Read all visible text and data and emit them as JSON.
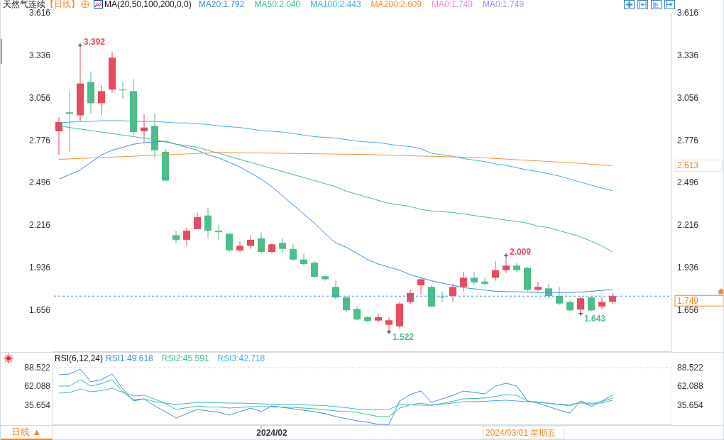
{
  "header": {
    "symbol": "天然气连续",
    "period": "【日线】",
    "indicator": "MA(20,50,100,200,0,0)",
    "values": [
      {
        "text": "MA20:1.792",
        "color": "#3d8ee6"
      },
      {
        "text": "MA50:2.040",
        "color": "#3cc08a"
      },
      {
        "text": "MA100:2.443",
        "color": "#45aee8"
      },
      {
        "text": "MA200:2.609",
        "color": "#f5923a"
      },
      {
        "text": "MA0:1.749",
        "color": "#ee88dd"
      },
      {
        "text": "MA0:1.749",
        "color": "#a58cf5"
      }
    ]
  },
  "main_chart": {
    "left_axis": [
      "3.616",
      "3.336",
      "3.056",
      "2.776",
      "2.496",
      "2.216",
      "1.936",
      "1.656"
    ],
    "right_axis": [
      "3.616",
      "3.336",
      "3.056",
      "2.776",
      "2.496",
      "2.216",
      "1.936",
      "1.656"
    ],
    "ma_tag": "2.613",
    "chart_data": {
      "type": "candlestick",
      "ylim": [
        1.383,
        3.616
      ],
      "yticks": [
        3.616,
        3.336,
        3.056,
        2.776,
        2.496,
        2.216,
        1.936,
        1.656
      ],
      "ohlc": [
        [
          2.835,
          2.93,
          2.68,
          2.896
        ],
        [
          2.96,
          3.1,
          2.7,
          2.95
        ],
        [
          2.94,
          3.392,
          2.9,
          3.15
        ],
        [
          3.16,
          3.23,
          2.95,
          3.02
        ],
        [
          3.02,
          3.14,
          2.94,
          3.1
        ],
        [
          3.11,
          3.36,
          3.09,
          3.32
        ],
        [
          3.11,
          3.16,
          3.05,
          3.105
        ],
        [
          3.1,
          3.18,
          2.81,
          2.83
        ],
        [
          2.835,
          2.95,
          2.76,
          2.86
        ],
        [
          2.87,
          2.95,
          2.66,
          2.71
        ],
        [
          2.7,
          2.72,
          2.51,
          2.51
        ],
        [
          2.15,
          2.18,
          2.1,
          2.12
        ],
        [
          2.12,
          2.2,
          2.08,
          2.18
        ],
        [
          2.19,
          2.3,
          2.19,
          2.27
        ],
        [
          2.28,
          2.33,
          2.13,
          2.18
        ],
        [
          2.18,
          2.22,
          2.12,
          2.17
        ],
        [
          2.16,
          2.16,
          2.04,
          2.05
        ],
        [
          2.05,
          2.11,
          2.04,
          2.08
        ],
        [
          2.08,
          2.15,
          2.06,
          2.12
        ],
        [
          2.13,
          2.17,
          2.03,
          2.04
        ],
        [
          2.04,
          2.1,
          2.03,
          2.09
        ],
        [
          2.1,
          2.13,
          2.03,
          2.06
        ],
        [
          2.06,
          2.09,
          1.98,
          1.99
        ],
        [
          1.99,
          2.03,
          1.95,
          1.96
        ],
        [
          1.97,
          1.98,
          1.87,
          1.876
        ],
        [
          1.88,
          1.89,
          1.85,
          1.86
        ],
        [
          1.81,
          1.85,
          1.73,
          1.74
        ],
        [
          1.74,
          1.75,
          1.64,
          1.656
        ],
        [
          1.665,
          1.68,
          1.59,
          1.595
        ],
        [
          1.61,
          1.62,
          1.574,
          1.585
        ],
        [
          1.588,
          1.63,
          1.575,
          1.61
        ],
        [
          1.56,
          1.61,
          1.522,
          1.59
        ],
        [
          1.55,
          1.71,
          1.535,
          1.7
        ],
        [
          1.71,
          1.79,
          1.7,
          1.77
        ],
        [
          1.82,
          1.87,
          1.76,
          1.86
        ],
        [
          1.81,
          1.82,
          1.68,
          1.68
        ],
        [
          1.745,
          1.78,
          1.71,
          1.74
        ],
        [
          1.75,
          1.83,
          1.71,
          1.81
        ],
        [
          1.81,
          1.91,
          1.78,
          1.87
        ],
        [
          1.87,
          1.91,
          1.825,
          1.84
        ],
        [
          1.845,
          1.87,
          1.82,
          1.83
        ],
        [
          1.87,
          1.98,
          1.85,
          1.92
        ],
        [
          1.92,
          2.009,
          1.9,
          1.95
        ],
        [
          1.95,
          1.97,
          1.91,
          1.92
        ],
        [
          1.935,
          1.94,
          1.78,
          1.79
        ],
        [
          1.79,
          1.84,
          1.78,
          1.81
        ],
        [
          1.8,
          1.83,
          1.74,
          1.75
        ],
        [
          1.75,
          1.81,
          1.69,
          1.7
        ],
        [
          1.71,
          1.72,
          1.65,
          1.655
        ],
        [
          1.66,
          1.745,
          1.643,
          1.735
        ],
        [
          1.74,
          1.75,
          1.646,
          1.655
        ],
        [
          1.68,
          1.745,
          1.665,
          1.71
        ],
        [
          1.712,
          1.77,
          1.7,
          1.749
        ]
      ],
      "series": [
        {
          "type": "line",
          "color": "#3d8ee6",
          "values": [
            2.52,
            2.55,
            2.58,
            2.63,
            2.68,
            2.71,
            2.73,
            2.75,
            2.76,
            2.765,
            2.77,
            2.75,
            2.73,
            2.71,
            2.68,
            2.66,
            2.63,
            2.6,
            2.56,
            2.52,
            2.47,
            2.41,
            2.35,
            2.29,
            2.23,
            2.16,
            2.1,
            2.07,
            2.03,
            1.99,
            1.96,
            1.94,
            1.92,
            1.89,
            1.87,
            1.85,
            1.835,
            1.82,
            1.805,
            1.797,
            1.789,
            1.781,
            1.779,
            1.777,
            1.775,
            1.773,
            1.773,
            1.773,
            1.773,
            1.776,
            1.781,
            1.787,
            1.792
          ]
        },
        {
          "type": "line",
          "color": "#3cc08a",
          "values": [
            2.87,
            2.86,
            2.85,
            2.84,
            2.83,
            2.82,
            2.81,
            2.8,
            2.79,
            2.78,
            2.765,
            2.75,
            2.74,
            2.73,
            2.71,
            2.69,
            2.67,
            2.65,
            2.63,
            2.61,
            2.59,
            2.57,
            2.55,
            2.53,
            2.51,
            2.49,
            2.47,
            2.44,
            2.42,
            2.4,
            2.38,
            2.36,
            2.35,
            2.34,
            2.32,
            2.31,
            2.305,
            2.3,
            2.29,
            2.28,
            2.27,
            2.26,
            2.25,
            2.24,
            2.23,
            2.21,
            2.2,
            2.18,
            2.16,
            2.14,
            2.11,
            2.08,
            2.04
          ]
        },
        {
          "type": "line",
          "color": "#45aee8",
          "values": [
            2.89,
            2.895,
            2.9,
            2.9,
            2.905,
            2.905,
            2.905,
            2.9,
            2.9,
            2.9,
            2.895,
            2.89,
            2.89,
            2.885,
            2.88,
            2.87,
            2.865,
            2.86,
            2.85,
            2.84,
            2.835,
            2.83,
            2.82,
            2.81,
            2.8,
            2.795,
            2.79,
            2.78,
            2.77,
            2.765,
            2.76,
            2.75,
            2.74,
            2.735,
            2.72,
            2.69,
            2.68,
            2.67,
            2.655,
            2.645,
            2.635,
            2.62,
            2.61,
            2.595,
            2.58,
            2.57,
            2.555,
            2.54,
            2.52,
            2.5,
            2.48,
            2.46,
            2.443
          ]
        },
        {
          "type": "line",
          "color": "#f5923a",
          "values": [
            2.65,
            2.653,
            2.656,
            2.659,
            2.662,
            2.665,
            2.668,
            2.671,
            2.674,
            2.677,
            2.68,
            2.683,
            2.686,
            2.689,
            2.692,
            2.695,
            2.695,
            2.694,
            2.693,
            2.692,
            2.691,
            2.69,
            2.689,
            2.688,
            2.687,
            2.686,
            2.685,
            2.684,
            2.683,
            2.682,
            2.68,
            2.678,
            2.676,
            2.674,
            2.672,
            2.67,
            2.668,
            2.666,
            2.664,
            2.662,
            2.66,
            2.656,
            2.652,
            2.648,
            2.644,
            2.64,
            2.636,
            2.632,
            2.628,
            2.624,
            2.618,
            2.613,
            2.609
          ]
        }
      ],
      "annotations": [
        "3.392",
        "2.009",
        "1.522",
        "1.643"
      ],
      "ref_lines": [
        {
          "axis": "y",
          "value": 1.749,
          "label": "1.749"
        }
      ]
    }
  },
  "rsi": {
    "indicator": "RSI(6,12,24)",
    "values": [
      {
        "text": "RSI1:49.618",
        "color": "#3d8ee6"
      },
      {
        "text": "RSI2:45.591",
        "color": "#3cc08a"
      },
      {
        "text": "RSI3:42.718",
        "color": "#45aee8"
      }
    ],
    "right_axis": [
      "88.522",
      "62.088",
      "35.654"
    ],
    "chart_data": {
      "type": "line",
      "ylim": [
        7.5,
        93.5
      ],
      "yticks": [
        88.522,
        62.088,
        35.654
      ],
      "series": [
        {
          "color": "#3d8ee6",
          "values": [
            78.5,
            79.5,
            86.5,
            68.5,
            71.5,
            79.5,
            58.5,
            41.5,
            44.5,
            34.5,
            26.5,
            17.5,
            23.5,
            29.5,
            27.5,
            25.5,
            21.5,
            26.5,
            31.5,
            26.5,
            34.5,
            32.5,
            30.5,
            28.5,
            26.5,
            23.5,
            19.5,
            16.5,
            13.5,
            11.5,
            8.5,
            8.5,
            41.5,
            50.5,
            55.5,
            39.5,
            44.5,
            49.5,
            55.5,
            53.5,
            51.5,
            62.5,
            66.5,
            62.5,
            41.5,
            38.5,
            33.5,
            28.5,
            24.5,
            41.5,
            33.5,
            41.5,
            49.6
          ]
        },
        {
          "color": "#3cc08a",
          "values": [
            62.5,
            62.5,
            71.5,
            62.5,
            66,
            71.5,
            54.5,
            48.5,
            49.5,
            44,
            38,
            29.5,
            32,
            34.5,
            33,
            33,
            31.5,
            32.5,
            33.5,
            33.5,
            33,
            33,
            32.5,
            31.5,
            30.5,
            29,
            27.5,
            26.5,
            25.5,
            22.5,
            19.5,
            19.5,
            31.5,
            36,
            38.5,
            35.5,
            38,
            41,
            44.5,
            45,
            45.5,
            48,
            50.5,
            49.5,
            41.5,
            40,
            38,
            36.5,
            34.5,
            40.5,
            36.5,
            40.5,
            45.6
          ]
        },
        {
          "color": "#45aee8",
          "values": [
            52.5,
            53.5,
            58.5,
            54.5,
            56,
            59.5,
            53.5,
            43.5,
            44.5,
            40.5,
            38.5,
            36.5,
            38,
            39.5,
            39,
            39,
            38.5,
            38.5,
            38,
            37.5,
            37,
            37,
            36.5,
            36,
            35.5,
            35,
            33.5,
            32,
            30,
            29.5,
            29.5,
            29.5,
            36.5,
            36,
            35.5,
            35.5,
            37,
            38.5,
            40.5,
            40.5,
            41,
            42,
            42.5,
            41.5,
            40.5,
            39.5,
            38.5,
            36.5,
            37,
            38.5,
            38.5,
            38.5,
            42.7
          ]
        }
      ]
    }
  },
  "time_axis": {
    "period_button": "日线 ▲",
    "month_label": "2024/02",
    "cursor_label": "2024/03/01 星期五"
  }
}
